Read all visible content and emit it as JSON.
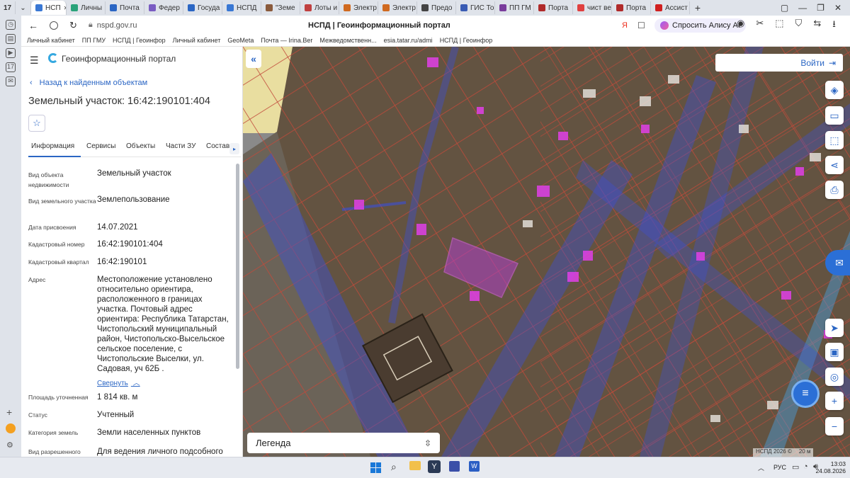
{
  "browser": {
    "tab_count": "17",
    "tabs": [
      {
        "label": "НСП",
        "color": "#3a78d4",
        "active": true
      },
      {
        "label": "Личны",
        "color": "#2aa37a"
      },
      {
        "label": "Почта",
        "color": "#2b66c4"
      },
      {
        "label": "Федер",
        "color": "#7a5cc2"
      },
      {
        "label": "Госуда",
        "color": "#2b66c4"
      },
      {
        "label": "НСПД",
        "color": "#3a78d4"
      },
      {
        "label": "\"Земе",
        "color": "#8a5a3c"
      },
      {
        "label": "Лоты и",
        "color": "#c04040"
      },
      {
        "label": "Электр",
        "color": "#d06a20"
      },
      {
        "label": "Электр",
        "color": "#d06a20"
      },
      {
        "label": "Предо",
        "color": "#444"
      },
      {
        "label": "ГИС То",
        "color": "#3a5cb4"
      },
      {
        "label": "ПП ГМ",
        "color": "#7a3c9c"
      },
      {
        "label": "Порта",
        "color": "#b02a2a"
      },
      {
        "label": "чист ве",
        "color": "#e04040"
      },
      {
        "label": "Порта",
        "color": "#b02a2a"
      },
      {
        "label": "Ассист",
        "color": "#d02020"
      }
    ],
    "url": "nspd.gov.ru",
    "page_title": "НСПД | Геоинформационный портал",
    "alice_button": "Спросить Алису AI",
    "bookmarks": [
      "Личный кабинет",
      "ПП ГМУ",
      "НСПД | Геоинфор",
      "Личный кабинет",
      "GeoMeta",
      "Почта — Irina.Ber",
      "Межведомственн...",
      "esia.tatar.ru/admi",
      "НСПД | Геоинфор"
    ]
  },
  "portal": {
    "logo_text": "Геоинформационный портал",
    "back_link": "Назад к найденным объектам",
    "object_title": "Земельный участок: 16:42:190101:404",
    "tabs": [
      "Информация",
      "Сервисы",
      "Объекты",
      "Части ЗУ",
      "Состав"
    ],
    "fields": [
      {
        "label": "Вид объекта недвижимости",
        "value": "Земельный участок"
      },
      {
        "label": "Вид земельного участка",
        "value": "Землепользование"
      },
      {
        "label": "Дата присвоения",
        "value": "14.07.2021"
      },
      {
        "label": "Кадастровый номер",
        "value": "16:42:190101:404"
      },
      {
        "label": "Кадастровый квартал",
        "value": "16:42:190101"
      },
      {
        "label": "Адрес",
        "value": "Местоположение установлено относительно ориентира, расположенного в границах участка. Почтовый адрес ориентира: Республика Татарстан, Чистопольский муниципальный район, Чистопольско-Высельское сельское поселение, с Чистопольские Выселки, ул. Садовая, уч 62Б ."
      },
      {
        "label": "Площадь уточненная",
        "value": "1 814 кв. м"
      },
      {
        "label": "Статус",
        "value": "Учтенный"
      },
      {
        "label": "Категория земель",
        "value": "Земли населенных пунктов"
      },
      {
        "label": "Вид разрешенного",
        "value": "Для ведения личного подсобного"
      }
    ],
    "collapse_link": "Свернуть"
  },
  "map": {
    "login": "Войти",
    "legend": "Легенда",
    "attribution": "НСПД 2026 ©",
    "scale": "20 м"
  },
  "taskbar": {
    "lang": "РУС",
    "time": "13:03",
    "date": "24.08.2026"
  }
}
